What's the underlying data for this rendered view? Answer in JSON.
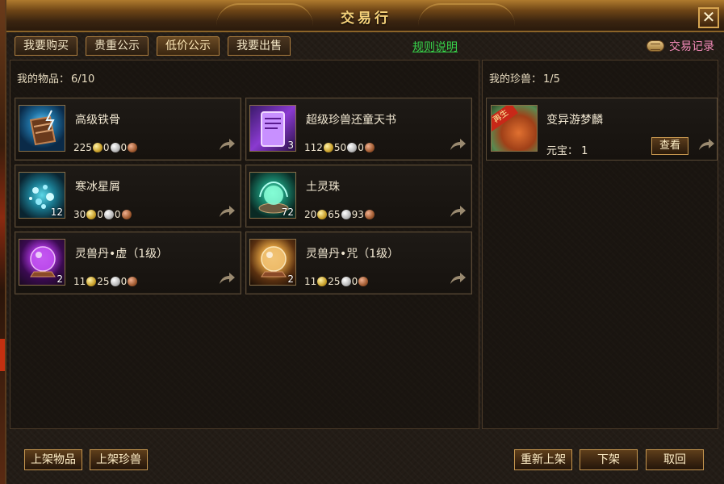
{
  "window": {
    "title": "交易行",
    "close_label": "✕"
  },
  "tabs": [
    {
      "label": "我要购买"
    },
    {
      "label": "贵重公示"
    },
    {
      "label": "低价公示"
    },
    {
      "label": "我要出售"
    }
  ],
  "rules_link": "规则说明",
  "trade_records": "交易记录",
  "items_panel": {
    "label": "我的物品：",
    "count": "6/10",
    "items": [
      {
        "name": "高级铁骨",
        "qty": "",
        "gold": "225",
        "silver": "0",
        "copper": "0"
      },
      {
        "name": "超级珍兽还童天书",
        "qty": "3",
        "gold": "112",
        "silver": "50",
        "copper": "0"
      },
      {
        "name": "寒冰星屑",
        "qty": "12",
        "gold": "30",
        "silver": "0",
        "copper": "0"
      },
      {
        "name": "土灵珠",
        "qty": "72",
        "gold": "20",
        "silver": "65",
        "copper": "93"
      },
      {
        "name": "灵兽丹•虚（1级）",
        "qty": "2",
        "gold": "11",
        "silver": "25",
        "copper": "0"
      },
      {
        "name": "灵兽丹•咒（1级）",
        "qty": "2",
        "gold": "11",
        "silver": "25",
        "copper": "0"
      }
    ]
  },
  "beasts_panel": {
    "label": "我的珍兽：",
    "count": "1/5",
    "beasts": [
      {
        "name": "变异游梦麟",
        "value_label": "元宝：",
        "value": "1",
        "view_label": "查看",
        "ribbon": "再生"
      }
    ]
  },
  "buttons": {
    "list_item": "上架物品",
    "list_beast": "上架珍兽",
    "relist": "重新上架",
    "delist": "下架",
    "cancel": "取回"
  }
}
